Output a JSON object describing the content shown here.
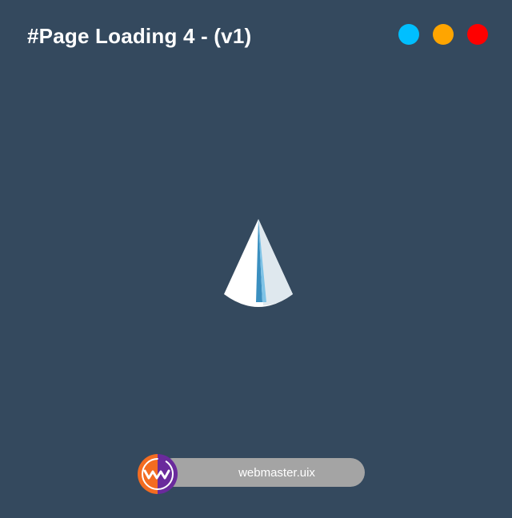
{
  "header": {
    "title": "#Page Loading 4 - (v1)"
  },
  "color_dots": [
    {
      "name": "blue",
      "color": "#00bfff"
    },
    {
      "name": "orange",
      "color": "#ffa500"
    },
    {
      "name": "red",
      "color": "#ff0000"
    }
  ],
  "loader": {
    "icon": "cone-loader-icon",
    "cone_color": "#ffffff",
    "shade_color": "#dfe8ee",
    "stripe_color": "#3a8fc0",
    "stripe_light_color": "#7fc3e6"
  },
  "credit": {
    "text": "webmaster.uix",
    "logo_icon": "wm-logo-icon",
    "logo_left_color": "#f36c21",
    "logo_right_color": "#6a2a9c",
    "pill_color": "#a4a4a4"
  }
}
